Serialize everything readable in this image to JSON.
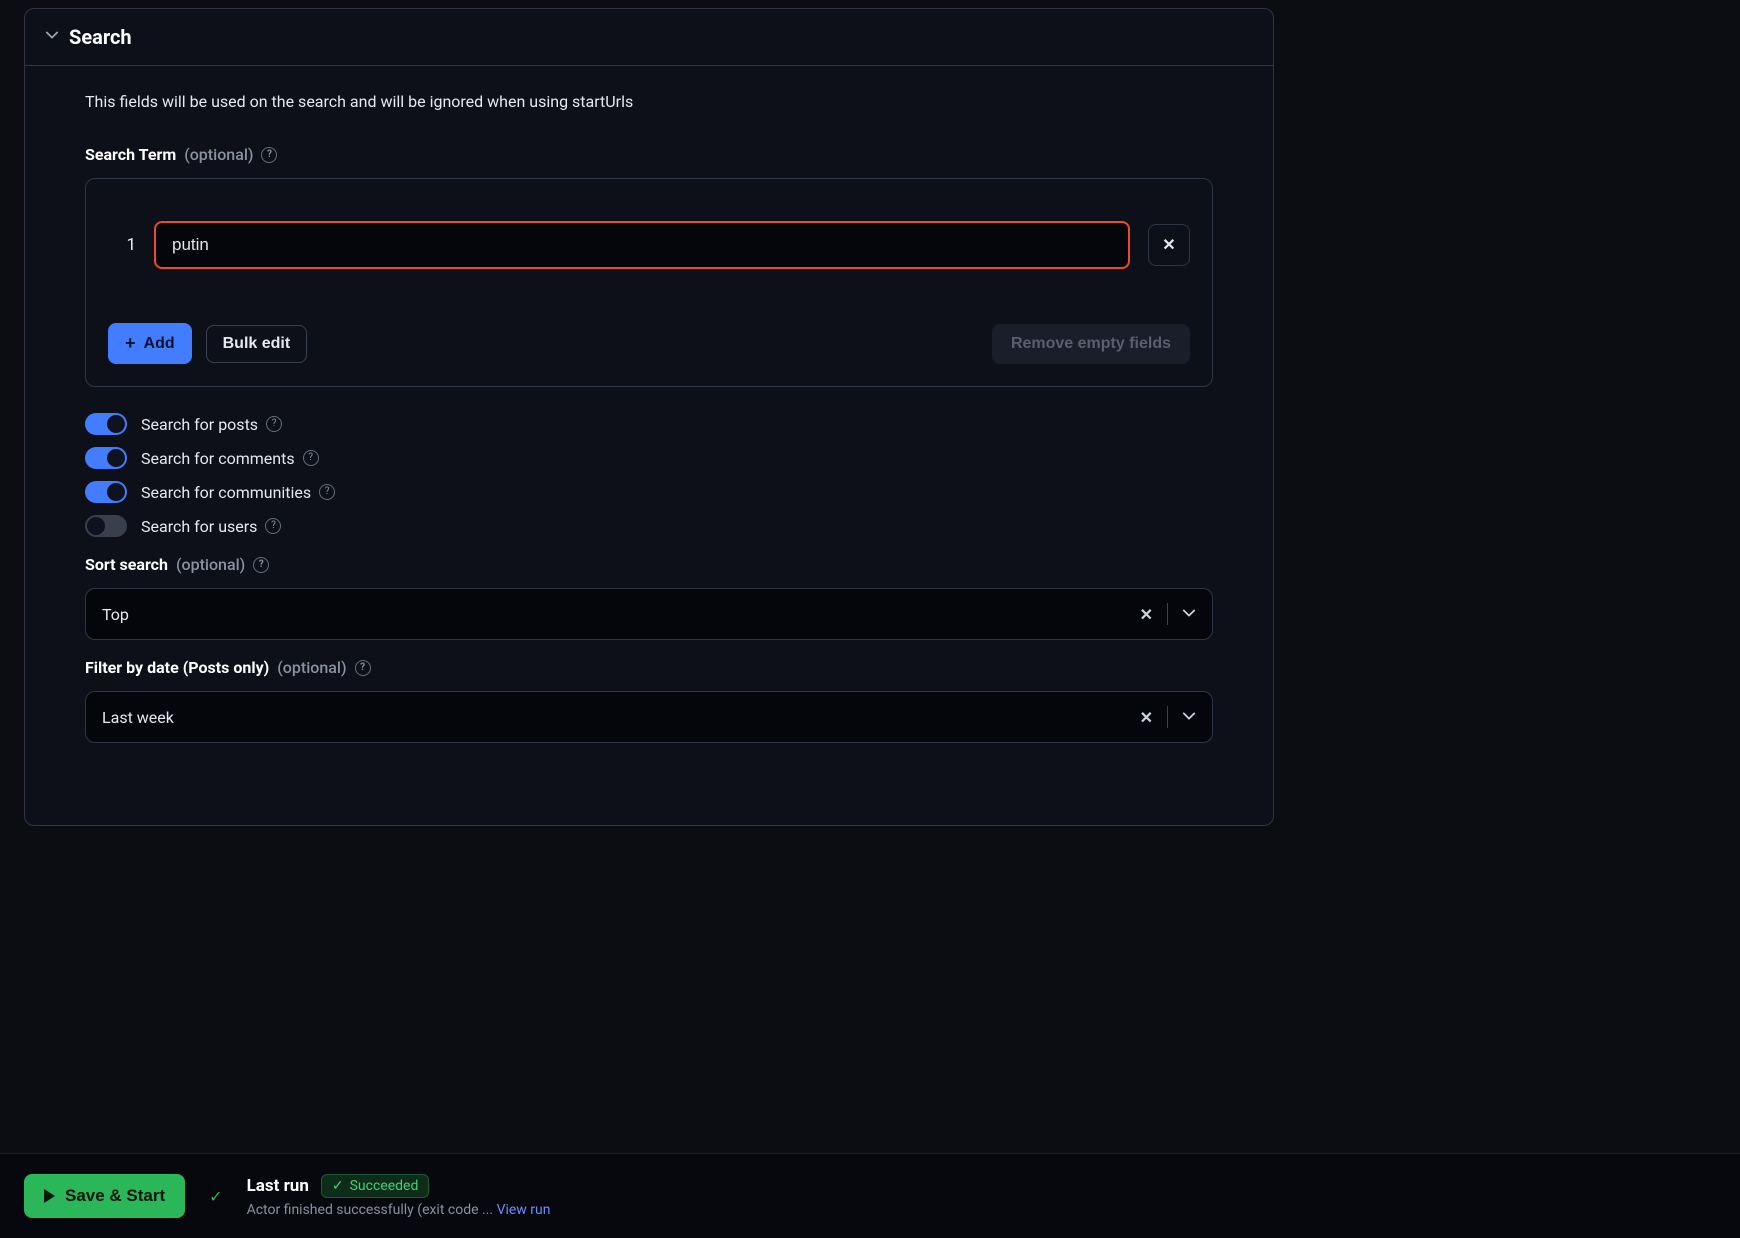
{
  "section": {
    "title": "Search",
    "description": "This fields will be used on the search and will be ignored when using startUrls"
  },
  "search_term": {
    "label": "Search Term",
    "optional": "(optional)",
    "items": [
      {
        "index": "1",
        "value": "putin"
      }
    ],
    "add_label": "Add",
    "bulk_edit_label": "Bulk edit",
    "remove_empty_label": "Remove empty fields"
  },
  "toggles": [
    {
      "label": "Search for posts",
      "on": true
    },
    {
      "label": "Search for comments",
      "on": true
    },
    {
      "label": "Search for communities",
      "on": true
    },
    {
      "label": "Search for users",
      "on": false
    }
  ],
  "sort": {
    "label": "Sort search",
    "optional": "(optional)",
    "value": "Top"
  },
  "filter_date": {
    "label": "Filter by date (Posts only)",
    "optional": "(optional)",
    "value": "Last week"
  },
  "footer": {
    "save_label": "Save & Start",
    "last_run_label": "Last run",
    "status_label": "Succeeded",
    "detail": "Actor finished successfully (exit code ...",
    "view_run": "View run"
  }
}
